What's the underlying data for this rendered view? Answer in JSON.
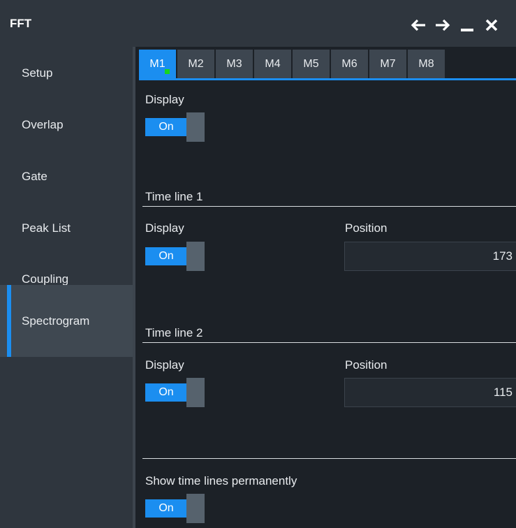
{
  "window": {
    "title": "FFT",
    "icons": [
      "arrow-left-icon",
      "arrow-right-icon",
      "minimize-icon",
      "close-icon"
    ]
  },
  "sidebar": {
    "items": [
      {
        "label": "Setup"
      },
      {
        "label": "Overlap"
      },
      {
        "label": "Gate"
      },
      {
        "label": "Peak List"
      },
      {
        "label": "Coupling"
      },
      {
        "label": "Spectrogram",
        "active": true
      }
    ]
  },
  "tabs": [
    {
      "label": "M1",
      "active": true,
      "indicator": "green-dot"
    },
    {
      "label": "M2"
    },
    {
      "label": "M3"
    },
    {
      "label": "M4"
    },
    {
      "label": "M5"
    },
    {
      "label": "M6"
    },
    {
      "label": "M7"
    },
    {
      "label": "M8"
    }
  ],
  "display": {
    "label": "Display",
    "toggle": "On"
  },
  "time_line_1": {
    "title": "Time line 1",
    "display_label": "Display",
    "display_toggle": "On",
    "position_label": "Position",
    "position_value": "173"
  },
  "time_line_2": {
    "title": "Time line 2",
    "display_label": "Display",
    "display_toggle": "On",
    "position_label": "Position",
    "position_value": "115"
  },
  "show_permanent": {
    "label": "Show time lines permanently",
    "toggle": "On"
  },
  "colors": {
    "accent": "#1b8ef0",
    "indicator": "#18d51d",
    "panel": "#2f363e",
    "background": "#1c2127"
  }
}
